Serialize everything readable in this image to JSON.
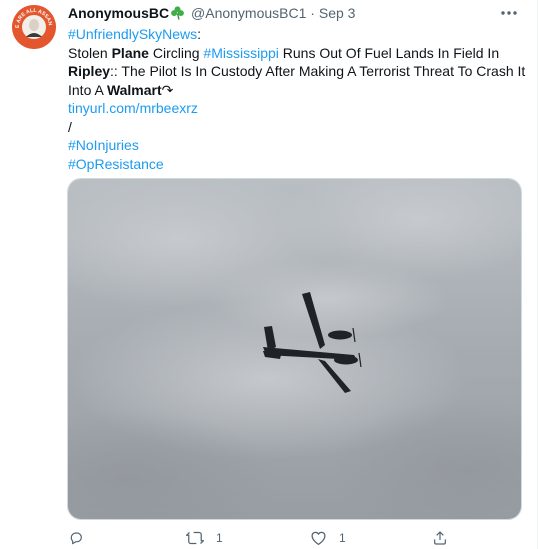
{
  "tweet": {
    "author_name": "AnonymousBC",
    "handle": "@AnonymousBC1",
    "separator": "·",
    "date": "Sep 3",
    "avatar_text": "WE ARE ALL ASSANGE",
    "body": {
      "line1_tag": "#UnfriendlySkyNews",
      "line1_rest": ":",
      "line2_a": "Stolen ",
      "line2_b": "Plane",
      "line2_c": " Circling ",
      "line2_tag": "#Mississippi",
      "line2_d": " Runs Out Of Fuel Lands In Field In",
      "line3_a": "Ripley",
      "line3_b": "::  The Pilot Is In Custody After Making A Terrorist Threat To Crash It",
      "line4_a": "Into A ",
      "line4_b": "Walmart",
      "line4_c": "↷",
      "link": "tinyurl.com/mrbeexrz",
      "slash": "/",
      "tag1": "#NoInjuries",
      "tag2": "#OpResistance"
    },
    "actions": {
      "reply_count": "",
      "retweet_count": "1",
      "like_count": "1"
    }
  }
}
